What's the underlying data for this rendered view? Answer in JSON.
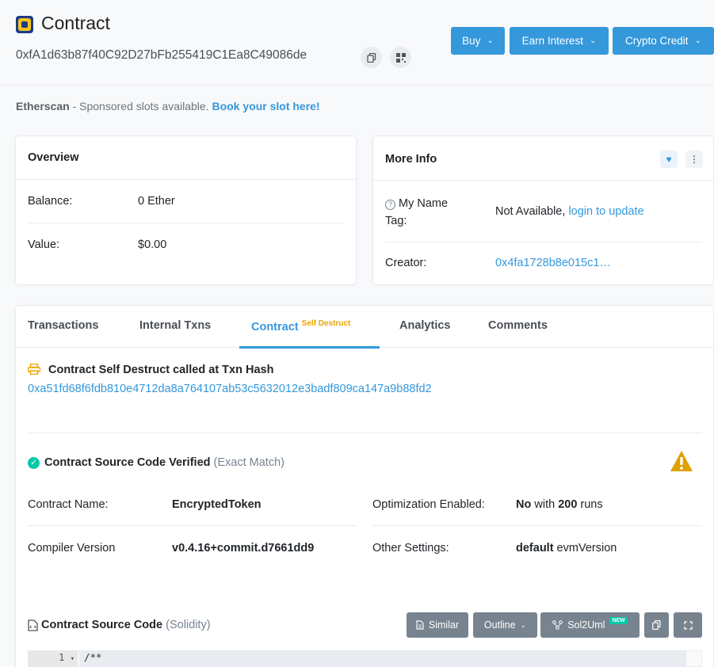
{
  "header": {
    "title": "Contract",
    "address": "0xfA1d63b87f40C92D27bFb255419C1Ea8C49086de",
    "buttons": {
      "buy": "Buy",
      "earn": "Earn Interest",
      "credit": "Crypto Credit"
    }
  },
  "sponsor": {
    "brand": "Etherscan",
    "text": " - Sponsored slots available. ",
    "link": "Book your slot here!"
  },
  "overview": {
    "title": "Overview",
    "balance_label": "Balance:",
    "balance_value": "0 Ether",
    "value_label": "Value:",
    "value_value": "$0.00"
  },
  "more_info": {
    "title": "More Info",
    "name_tag_label_1": "My Name",
    "name_tag_label_2": "Tag:",
    "name_tag_value": "Not Available, ",
    "name_tag_link": "login to update",
    "creator_label": "Creator:",
    "creator_value": "0x4fa1728b8e015c1…"
  },
  "tabs": {
    "transactions": "Transactions",
    "internal": "Internal Txns",
    "contract": "Contract",
    "contract_badge": "Self Destruct",
    "analytics": "Analytics",
    "comments": "Comments"
  },
  "self_destruct": {
    "title": "Contract Self Destruct called at Txn Hash",
    "hash": "0xa51fd68f6fdb810e4712da8a764107ab53c5632012e3badf809ca147a9b88fd2"
  },
  "verified": {
    "title": "Contract Source Code Verified",
    "match": "(Exact Match)"
  },
  "details": {
    "name_label": "Contract Name:",
    "name_value": "EncryptedToken",
    "optimization_label": "Optimization Enabled:",
    "optimization_flag": "No",
    "optimization_with": " with ",
    "optimization_runs": "200",
    "optimization_suffix": " runs",
    "compiler_label": "Compiler Version",
    "compiler_value": "v0.4.16+commit.d7661dd9",
    "settings_label": "Other Settings:",
    "settings_bold": "default",
    "settings_suffix": " evmVersion"
  },
  "source": {
    "title": "Contract Source Code",
    "lang": "(Solidity)",
    "similar": "Similar",
    "outline": "Outline",
    "sol2uml": "Sol2Uml",
    "new_badge": "NEW",
    "line_no": "1",
    "line_text": "/**"
  },
  "colors": {
    "accent": "#3498db",
    "warning": "#f0a500",
    "success": "#00c9a7",
    "gray_button": "#77838f"
  }
}
